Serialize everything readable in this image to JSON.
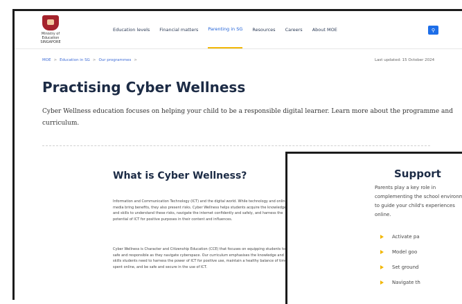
{
  "header": {
    "logo_text": "Ministry of Education SINGAPORE",
    "nav": [
      {
        "label": "Education levels"
      },
      {
        "label": "Financial matters"
      },
      {
        "label": "Parenting in SG",
        "active": true
      },
      {
        "label": "Resources"
      },
      {
        "label": "Careers"
      },
      {
        "label": "About MOE"
      }
    ],
    "search_icon": "search-icon"
  },
  "breadcrumb": [
    "MOE",
    "Education in SG",
    "Our programmes"
  ],
  "updated": "Last updated: 15 October 2024",
  "page": {
    "title": "Practising Cyber Wellness",
    "lead": "Cyber Wellness education focuses on helping your child to be a responsible digital learner. Learn more about the programme and curriculum."
  },
  "section": {
    "title": "What is Cyber Wellness?",
    "p1": "Information and Communication Technology (ICT) and the digital world. While technology and online media bring benefits, they also present risks. Cyber Wellness helps students acquire the knowledge and skills to understand these risks, navigate the internet confidently and safely, and harness the potential of ICT for positive purposes in their content and influences.",
    "p2": "Cyber Wellness is Character and Citizenship Education (CCE) that focuses on equipping students to be safe and responsible as they navigate cyberspace. Our curriculum emphasises the knowledge and skills students need to harness the power of ICT for positive use, maintain a healthy balance of time spent online, and be safe and secure in the use of ICT."
  },
  "support": {
    "title": "Support",
    "para": "Parents play a key role in complementing the school environment to guide your child's experiences online.",
    "bullets": [
      "Activate pa",
      "Model goo",
      "Set ground",
      "Navigate th"
    ]
  },
  "colors": {
    "accent": "#1d6ee8",
    "highlight": "#f2b705",
    "brand": "#a4232c"
  }
}
